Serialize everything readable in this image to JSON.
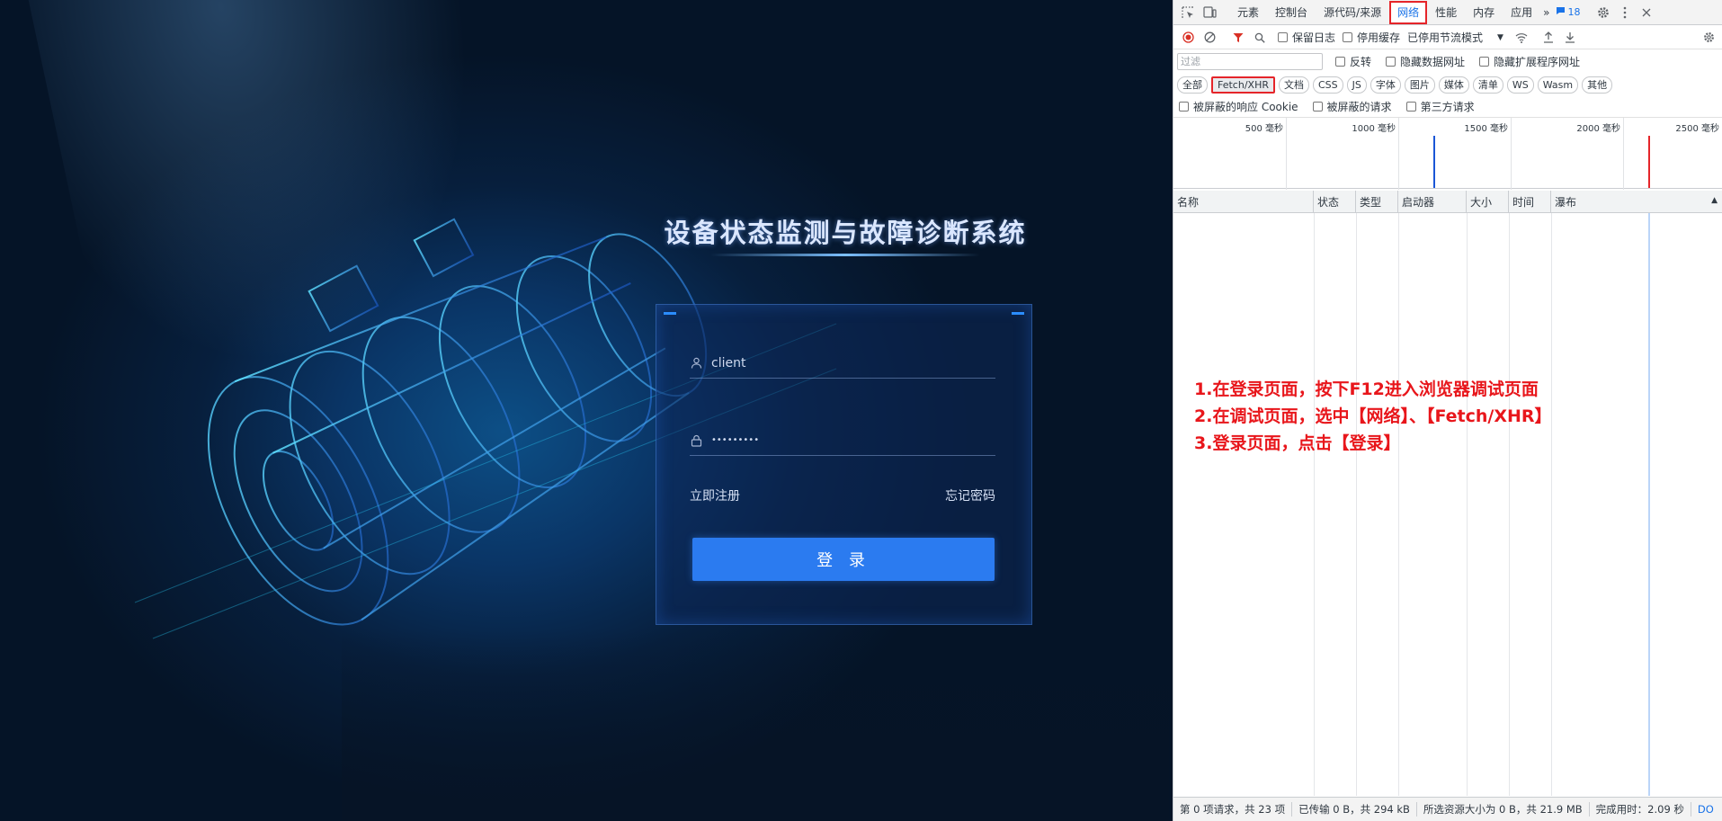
{
  "login": {
    "title": "设备状态监测与故障诊断系统",
    "username_value": "client",
    "password_mask": "•••••••••",
    "register_link": "立即注册",
    "forgot_link": "忘记密码",
    "login_button": "登 录"
  },
  "devtools": {
    "tabs": [
      {
        "label": "元素"
      },
      {
        "label": "控制台"
      },
      {
        "label": "源代码/来源"
      },
      {
        "label": "网络"
      },
      {
        "label": "性能"
      },
      {
        "label": "内存"
      },
      {
        "label": "应用"
      }
    ],
    "more_tabs": "»",
    "message_count": "18",
    "toolbar": {
      "preserve_log": "保留日志",
      "disable_cache": "停用缓存",
      "throttle": "已停用节流模式"
    },
    "filter": {
      "placeholder": "过滤",
      "invert": "反转",
      "hide_data_urls": "隐藏数据网址",
      "hide_extension_urls": "隐藏扩展程序网址"
    },
    "types": [
      "全部",
      "Fetch/XHR",
      "文档",
      "CSS",
      "JS",
      "字体",
      "图片",
      "媒体",
      "清单",
      "WS",
      "Wasm",
      "其他"
    ],
    "selected_type": "Fetch/XHR",
    "cookie_row": {
      "blocked_cookies": "被屏蔽的响应 Cookie",
      "blocked_requests": "被屏蔽的请求",
      "third_party": "第三方请求"
    },
    "timeline_ticks": [
      "500 毫秒",
      "1000 毫秒",
      "1500 毫秒",
      "2000 毫秒",
      "2500 毫秒"
    ],
    "columns": [
      "名称",
      "状态",
      "类型",
      "启动器",
      "大小",
      "时间",
      "瀑布"
    ],
    "statusbar": {
      "requests": "第 0 项请求，共 23 项",
      "transferred": "已传输 0 B，共 294 kB",
      "resources": "所选资源大小为 0 B，共 21.9 MB",
      "finish": "完成用时：2.09 秒",
      "dom": "DO"
    },
    "colors": {
      "highlight": "#e5252a",
      "accent": "#1a73e8"
    }
  },
  "instructions": [
    "1.在登录页面，按下F12进入浏览器调试页面",
    "2.在调试页面，选中【网络】、【Fetch/XHR】",
    "3.登录页面，点击【登录】"
  ]
}
